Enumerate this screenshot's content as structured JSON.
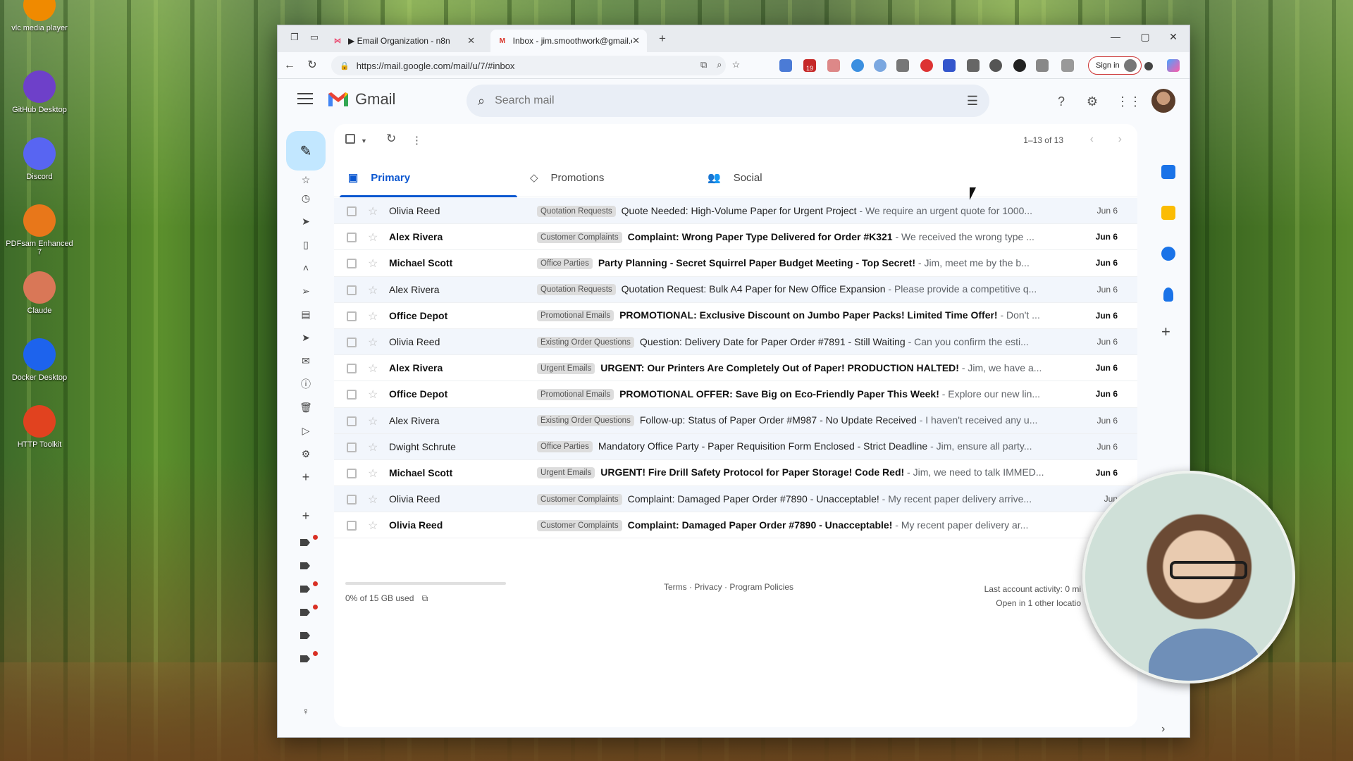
{
  "desktop": {
    "icons": [
      {
        "label": "vlc media player",
        "icon": "vlc-icon",
        "color": "#f08a00"
      },
      {
        "label": "GitHub Desktop",
        "icon": "github-icon",
        "color": "#6e40c9"
      },
      {
        "label": "Discord",
        "icon": "discord-icon",
        "color": "#5865f2"
      },
      {
        "label": "PDFsam Enhanced 7",
        "icon": "pdfsam-icon",
        "color": "#e8771a"
      },
      {
        "label": "Claude",
        "icon": "claude-icon",
        "color": "#d97757"
      },
      {
        "label": "Docker Desktop",
        "icon": "docker-icon",
        "color": "#1d63ed"
      },
      {
        "label": "HTTP Toolkit",
        "icon": "http-toolkit-icon",
        "color": "#e1421f"
      }
    ]
  },
  "browser": {
    "tabs": [
      {
        "label": "▶ Email Organization - n8n",
        "icon": "n8n-icon",
        "active": false
      },
      {
        "label": "Inbox - jim.smoothwork@gmail.c",
        "icon": "gmail-icon",
        "active": true
      }
    ],
    "url": "https://mail.google.com/mail/u/7/#inbox",
    "sign_in_label": "Sign in",
    "extension_badge": "19"
  },
  "gmail": {
    "brand": "Gmail",
    "search_placeholder": "Search mail",
    "pager": "1–13 of 13",
    "tabs": [
      {
        "label": "Primary",
        "icon": "inbox-icon",
        "active": true
      },
      {
        "label": "Promotions",
        "icon": "tag-icon",
        "active": false
      },
      {
        "label": "Social",
        "icon": "people-icon",
        "active": false
      }
    ],
    "emails": [
      {
        "sender": "Olivia Reed",
        "label": "Quotation Requests",
        "subject": "Quote Needed: High-Volume Paper for Urgent Project",
        "snippet": " - We require an urgent quote for 1000...",
        "date": "Jun 6",
        "unread": false
      },
      {
        "sender": "Alex Rivera",
        "label": "Customer Complaints",
        "subject": "Complaint: Wrong Paper Type Delivered for Order #K321",
        "snippet": " - We received the wrong type ...",
        "date": "Jun 6",
        "unread": true
      },
      {
        "sender": "Michael Scott",
        "label": "Office Parties",
        "subject": "Party Planning - Secret Squirrel Paper Budget Meeting - Top Secret!",
        "snippet": " - Jim, meet me by the b...",
        "date": "Jun 6",
        "unread": true
      },
      {
        "sender": "Alex Rivera",
        "label": "Quotation Requests",
        "subject": "Quotation Request: Bulk A4 Paper for New Office Expansion",
        "snippet": " - Please provide a competitive q...",
        "date": "Jun 6",
        "unread": false
      },
      {
        "sender": "Office Depot",
        "label": "Promotional Emails",
        "subject": "PROMOTIONAL: Exclusive Discount on Jumbo Paper Packs! Limited Time Offer!",
        "snippet": " - Don't ...",
        "date": "Jun 6",
        "unread": true
      },
      {
        "sender": "Olivia Reed",
        "label": "Existing Order Questions",
        "subject": "Question: Delivery Date for Paper Order #7891 - Still Waiting",
        "snippet": " - Can you confirm the esti...",
        "date": "Jun 6",
        "unread": false
      },
      {
        "sender": "Alex Rivera",
        "label": "Urgent Emails",
        "subject": "URGENT: Our Printers Are Completely Out of Paper! PRODUCTION HALTED!",
        "snippet": " - Jim, we have a...",
        "date": "Jun 6",
        "unread": true
      },
      {
        "sender": "Office Depot",
        "label": "Promotional Emails",
        "subject": "PROMOTIONAL OFFER: Save Big on Eco-Friendly Paper This Week!",
        "snippet": " - Explore our new lin...",
        "date": "Jun 6",
        "unread": true
      },
      {
        "sender": "Alex Rivera",
        "label": "Existing Order Questions",
        "subject": "Follow-up: Status of Paper Order #M987 - No Update Received",
        "snippet": " - I haven't received any u...",
        "date": "Jun 6",
        "unread": false
      },
      {
        "sender": "Dwight Schrute",
        "label": "Office Parties",
        "subject": "Mandatory Office Party - Paper Requisition Form Enclosed - Strict Deadline",
        "snippet": " - Jim, ensure all party...",
        "date": "Jun 6",
        "unread": false
      },
      {
        "sender": "Michael Scott",
        "label": "Urgent Emails",
        "subject": "URGENT! Fire Drill Safety Protocol for Paper Storage! Code Red!",
        "snippet": " - Jim, we need to talk IMMED...",
        "date": "Jun 6",
        "unread": true
      },
      {
        "sender": "Olivia Reed",
        "label": "Customer Complaints",
        "subject": "Complaint: Damaged Paper Order #7890 - Unacceptable!",
        "snippet": " - My recent paper delivery arrive...",
        "date": "Jun",
        "unread": false
      },
      {
        "sender": "Olivia Reed",
        "label": "Customer Complaints",
        "subject": "Complaint: Damaged Paper Order #7890 - Unacceptable!",
        "snippet": " - My recent paper delivery ar...",
        "date": "",
        "unread": true
      }
    ],
    "footer": {
      "storage": "0% of 15 GB used",
      "storage_fraction": 0,
      "links": "Terms · Privacy · Program Policies",
      "activity": "Last account activity: 0 mi",
      "other_location": "Open in 1 other locatio"
    }
  },
  "colors": {
    "accent": "#0b57d0",
    "compose_bg": "#c2e7ff",
    "unread_bg": "#ffffff",
    "read_bg": "#f2f6fc"
  }
}
